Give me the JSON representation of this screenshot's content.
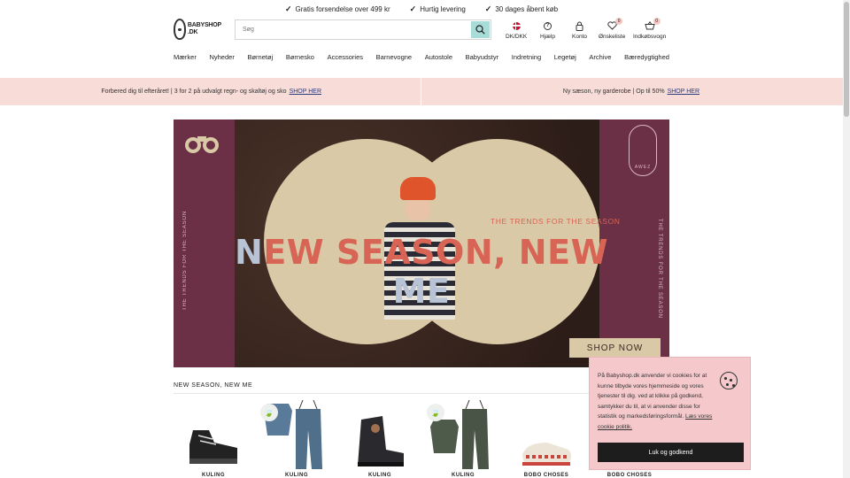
{
  "topbar": {
    "usps": [
      "Gratis forsendelse over 499 kr",
      "Hurtig levering",
      "30 dages åbent køb"
    ]
  },
  "logo": {
    "line1": "BABYSHOP",
    "line2": ".DK"
  },
  "search": {
    "placeholder": "Søg"
  },
  "header_icons": {
    "currency": "DK/DKK",
    "help": "Hjælp",
    "account": "Konto",
    "wishlist": "Ønskeliste",
    "wishlist_count": "0",
    "cart": "Indkøbsvogn",
    "cart_count": "0"
  },
  "nav": {
    "items": [
      "Mærker",
      "Nyheder",
      "Børnetøj",
      "Børnesko",
      "Accessories",
      "Barnevogne",
      "Autostole",
      "Babyudstyr",
      "Indretning",
      "Legetøj",
      "Archive",
      "Bæredygtighed"
    ]
  },
  "promo": {
    "left_text": "Forbered dig til efteråret! | 3 for 2 på udvalgt regn- og skaltøj og sko",
    "left_link": "SHOP HER",
    "right_text": "Ny sæson, ny garderobe | Op til 50%",
    "right_link": "SHOP HER"
  },
  "hero": {
    "headline_start": "N",
    "headline_mid": "EW SEASON, NEW ",
    "headline_end": "ME",
    "tagline": "THE TRENDS FOR THE SEASON",
    "vertical_left": "THE TRENDS FOR THE SEASON",
    "vertical_right": "THE TRENDS FOR THE SEASON",
    "brand_mark": "AWEZ",
    "cta": "SHOP NOW"
  },
  "products_section": {
    "title": "NEW SEASON, NEW ME",
    "items": [
      {
        "brand": "KULING"
      },
      {
        "brand": "KULING"
      },
      {
        "brand": "KULING"
      },
      {
        "brand": "KULING"
      },
      {
        "brand": "BOBO CHOSES"
      },
      {
        "brand": "BOBO CHOSES"
      }
    ]
  },
  "cookie": {
    "text": "På Babyshop.dk anvender vi cookies for at kunne tilbyde vores hjemmeside og vores tjenester til dig. ved at klikke på godkend, samtykker du til, at vi anvender disse for statistik og markedsføringsformål.",
    "link": "Læs vores cookie politik.",
    "button": "Luk og godkend"
  },
  "colors": {
    "promo_bg": "#f7dcd8",
    "hero_panel": "#6b3045",
    "headline": "#d86455",
    "search_button": "#a8dcd9",
    "cookie_bg": "#f5c9cc"
  }
}
